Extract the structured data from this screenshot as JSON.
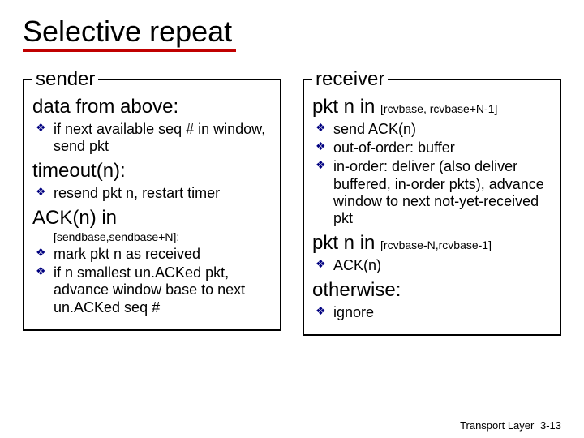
{
  "title": "Selective repeat",
  "sender": {
    "legend": "sender",
    "h1": "data from above:",
    "h1_items": [
      "if next available seq # in window, send pkt"
    ],
    "h2": "timeout(n):",
    "h2_items": [
      "resend pkt n, restart timer"
    ],
    "h3": "ACK(n) in",
    "h3_sub": "[sendbase,sendbase+N]:",
    "h3_items": [
      "mark pkt n as received",
      "if n smallest un.ACKed pkt, advance window base to next un.ACKed seq #"
    ]
  },
  "receiver": {
    "legend": "receiver",
    "h1": "pkt n in ",
    "h1_small": "[rcvbase, rcvbase+N-1]",
    "h1_items": [
      "send ACK(n)",
      "out-of-order: buffer",
      "in-order: deliver (also deliver buffered, in-order pkts), advance window to next not-yet-received pkt"
    ],
    "h2": "pkt n in ",
    "h2_small": "[rcvbase-N,rcvbase-1]",
    "h2_items": [
      "ACK(n)"
    ],
    "h3": "otherwise:",
    "h3_items": [
      "ignore"
    ]
  },
  "footer": {
    "label": "Transport Layer",
    "page": "3-13"
  }
}
